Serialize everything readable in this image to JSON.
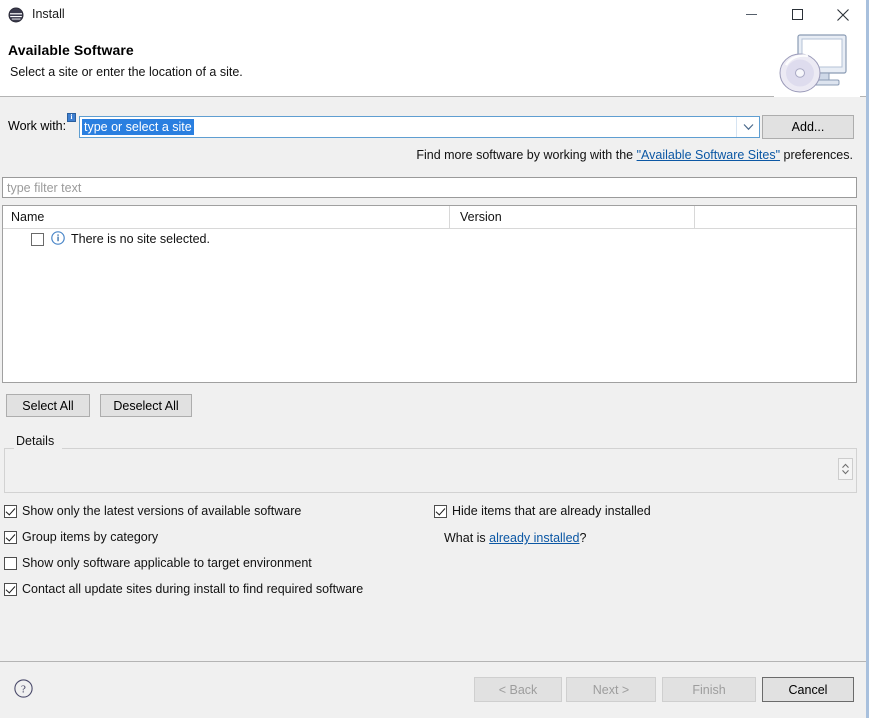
{
  "window": {
    "title": "Install",
    "icon": "eclipse-icon",
    "controls": {
      "minimize": "minimize-icon",
      "maximize": "maximize-icon",
      "close": "close-icon"
    }
  },
  "header": {
    "title": "Available Software",
    "subtitle": "Select a site or enter the location of a site.",
    "graphic": "monitor-with-disc-icon"
  },
  "work_with": {
    "label": "Work with:",
    "badge": "i",
    "value": "type or select a site",
    "placeholder": "type or select a site",
    "arrow_icon": "chevron-down-icon",
    "add_label": "Add..."
  },
  "find_more": {
    "prefix": "Find more software by working with the ",
    "link": "\"Available Software Sites\"",
    "suffix": " preferences."
  },
  "filter": {
    "placeholder": "type filter text",
    "value": ""
  },
  "table": {
    "columns": [
      {
        "label": "Name"
      },
      {
        "label": "Version"
      }
    ],
    "rows": [
      {
        "checked": false,
        "icon": "info-circle-icon",
        "name": "There is no site selected.",
        "version": ""
      }
    ]
  },
  "selection_buttons": {
    "select_all": "Select All",
    "deselect_all": "Deselect All"
  },
  "details": {
    "legend": "Details",
    "content": "",
    "spinner_icon": "vertical-stepper-icon"
  },
  "options": {
    "left": [
      {
        "label": "Show only the latest versions of available software",
        "checked": true
      },
      {
        "label": "Group items by category",
        "checked": true
      },
      {
        "label": "Show only software applicable to target environment",
        "checked": false
      },
      {
        "label": "Contact all update sites during install to find required software",
        "checked": true
      }
    ],
    "right": [
      {
        "label": "Hide items that are already installed",
        "checked": true
      }
    ],
    "what_is": {
      "prefix": "What is ",
      "link": "already installed",
      "suffix": "?"
    }
  },
  "footer": {
    "help_icon": "help-icon",
    "back": "< Back",
    "next": "Next >",
    "finish": "Finish",
    "cancel": "Cancel"
  },
  "colors": {
    "link": "#0b57a4",
    "selection": "#2a7fe0",
    "dialog_bg": "#f0f0f0",
    "header_bg": "#ffffff"
  }
}
